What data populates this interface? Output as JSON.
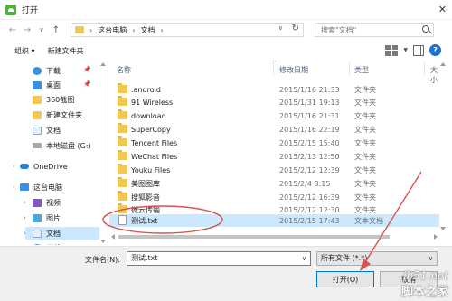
{
  "window": {
    "title": "打开",
    "close_glyph": "✕"
  },
  "nav": {
    "back": "←",
    "forward": "→",
    "dropdown": "∨",
    "up": "↑"
  },
  "address": {
    "crumbs": [
      "这台电脑",
      "文档"
    ],
    "separator": "›",
    "refresh": "↻"
  },
  "search": {
    "placeholder": "搜索\"文档\""
  },
  "toolbar": {
    "organize_label": "组织 ▾",
    "new_folder_label": "新建文件夹",
    "help_label": "?"
  },
  "sidebar": {
    "items": [
      {
        "label": "下载",
        "icon": "download-icon",
        "pinned": true
      },
      {
        "label": "桌面",
        "icon": "desktop-icon",
        "pinned": true
      },
      {
        "label": "360截图",
        "icon": "folder-icon",
        "pinned": false
      },
      {
        "label": "新建文件夹",
        "icon": "folder-icon",
        "pinned": false
      },
      {
        "label": "文档",
        "icon": "document-icon",
        "pinned": false
      },
      {
        "label": "本地磁盘 (G:)",
        "icon": "drive-icon",
        "pinned": false
      },
      {
        "label": "OneDrive",
        "icon": "cloud-icon",
        "pinned": false
      },
      {
        "label": "这台电脑",
        "icon": "pc-icon",
        "pinned": false
      },
      {
        "label": "视频",
        "icon": "video-icon",
        "pinned": false
      },
      {
        "label": "图片",
        "icon": "picture-icon",
        "pinned": false
      },
      {
        "label": "文档",
        "icon": "document-icon",
        "pinned": false,
        "selected": true
      },
      {
        "label": "下载",
        "icon": "download-icon",
        "pinned": false
      }
    ],
    "pin_glyph": "📌",
    "expander_glyph": "›"
  },
  "filelist": {
    "columns": [
      "名称",
      "修改日期",
      "类型",
      "大小"
    ],
    "sort_caret": "^",
    "rows": [
      {
        "name": ".android",
        "date": "2015/1/16 21:33",
        "type": "文件夹",
        "kind": "folder"
      },
      {
        "name": "91 Wireless",
        "date": "2015/1/31 19:13",
        "type": "文件夹",
        "kind": "folder"
      },
      {
        "name": "download",
        "date": "2015/1/16 21:31",
        "type": "文件夹",
        "kind": "folder"
      },
      {
        "name": "SuperCopy",
        "date": "2015/1/16 22:19",
        "type": "文件夹",
        "kind": "folder"
      },
      {
        "name": "Tencent Files",
        "date": "2015/2/15 15:40",
        "type": "文件夹",
        "kind": "folder"
      },
      {
        "name": "WeChat Files",
        "date": "2015/2/13 12:50",
        "type": "文件夹",
        "kind": "folder"
      },
      {
        "name": "Youku Files",
        "date": "2015/2/12 12:39",
        "type": "文件夹",
        "kind": "folder"
      },
      {
        "name": "美图图库",
        "date": "2015/2/4 8:15",
        "type": "文件夹",
        "kind": "folder"
      },
      {
        "name": "搜狐影音",
        "date": "2015/2/12 16:39",
        "type": "文件夹",
        "kind": "folder"
      },
      {
        "name": "微云传输",
        "date": "2015/2/12 12:30",
        "type": "文件夹",
        "kind": "folder"
      },
      {
        "name": "测试.txt",
        "date": "2015/2/15 17:43",
        "type": "文本文档",
        "kind": "txt",
        "selected": true
      }
    ]
  },
  "bottom": {
    "filename_label": "文件名(N):",
    "filename_value": "测试.txt",
    "filetype_value": "所有文件 (*.*)",
    "open_label": "打开(O)",
    "cancel_label": "取消",
    "dropdown_glyph": "∨"
  },
  "annotation": {
    "color": "#d9534f"
  },
  "watermark": {
    "line1": "jb51.net",
    "line2": "脚本之家"
  }
}
